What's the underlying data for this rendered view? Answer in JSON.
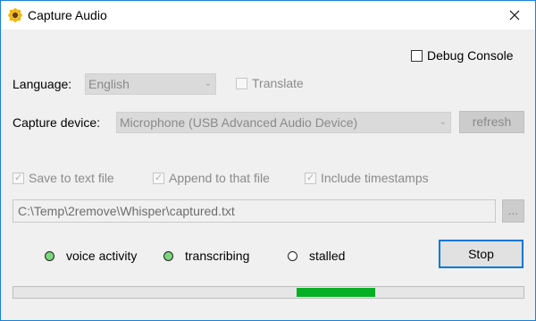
{
  "window": {
    "title": "Capture Audio",
    "icon": "sunflower-icon",
    "close_icon": "close-icon"
  },
  "debug_console": {
    "label": "Debug Console",
    "checked": false
  },
  "language": {
    "label": "Language:",
    "selected": "English",
    "translate_label": "Translate",
    "translate_checked": false
  },
  "capture_device": {
    "label": "Capture device:",
    "selected": "Microphone (USB Advanced Audio Device)",
    "refresh_label": "refresh"
  },
  "output": {
    "save_to_text_file": {
      "label": "Save to text file",
      "checked": true
    },
    "append_to_that_file": {
      "label": "Append to that file",
      "checked": true
    },
    "include_timestamps": {
      "label": "Include timestamps",
      "checked": true
    },
    "path": "C:\\Temp\\2remove\\Whisper\\captured.txt",
    "browse_label": "..."
  },
  "status": {
    "voice_activity": {
      "label": "voice activity",
      "color": "#7cd67c"
    },
    "transcribing": {
      "label": "transcribing",
      "color": "#7cd67c"
    },
    "stalled": {
      "label": "stalled",
      "color": "#ffffff"
    }
  },
  "stop_label": "Stop",
  "progress": {
    "color": "#06b025",
    "marquee": true
  }
}
